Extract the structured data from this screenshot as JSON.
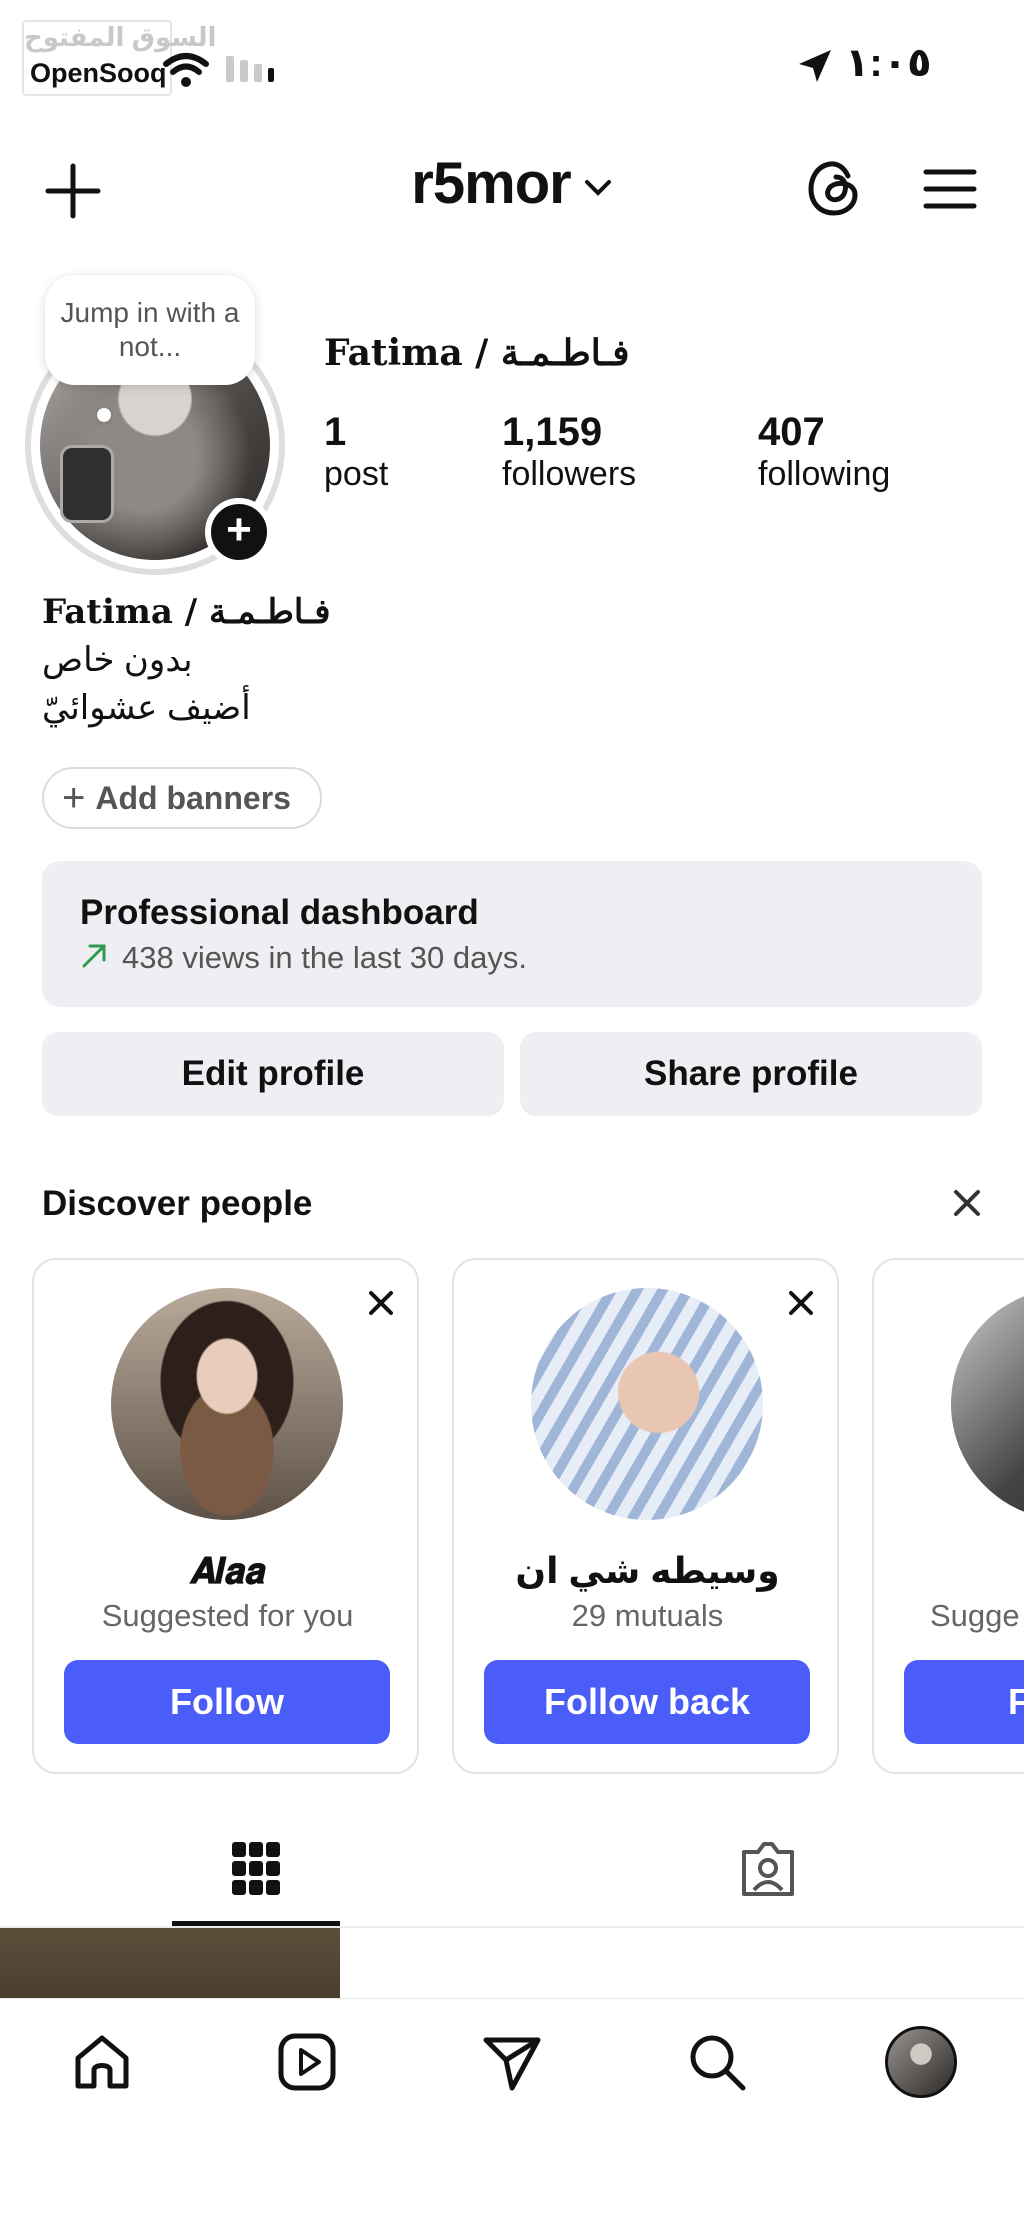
{
  "status_bar": {
    "watermark_ar": "السوق المفتوح",
    "watermark_en": "OpenSooq",
    "time": "١:٠٥"
  },
  "header": {
    "username": "r5mor"
  },
  "profile": {
    "note": "Jump in with a not...",
    "display_name": "Fatima / فـاطـمـة",
    "stats": [
      {
        "value": "1",
        "label": "post"
      },
      {
        "value": "1,159",
        "label": "followers"
      },
      {
        "value": "407",
        "label": "following"
      }
    ],
    "bio_name": "Fatima / فـاطـمـة",
    "bio_lines": [
      "بدون خاص",
      "أضيف عشوائيّ"
    ],
    "add_banners": "Add banners"
  },
  "dashboard": {
    "title": "Professional dashboard",
    "subtitle": "438 views in the last 30 days."
  },
  "actions": {
    "edit": "Edit profile",
    "share": "Share profile"
  },
  "discover": {
    "title": "Discover people",
    "cards": [
      {
        "name": "𝑨𝒍𝒂𝒂",
        "sub": "Suggested for you",
        "button": "Follow"
      },
      {
        "name": "وسيطه شي ان",
        "sub": "29 mutuals",
        "button": "Follow back"
      },
      {
        "name": "",
        "sub": "Sugge",
        "button": "F"
      }
    ]
  },
  "colors": {
    "accent": "#4a5df9",
    "trend_arrow": "#2e9b4c"
  }
}
